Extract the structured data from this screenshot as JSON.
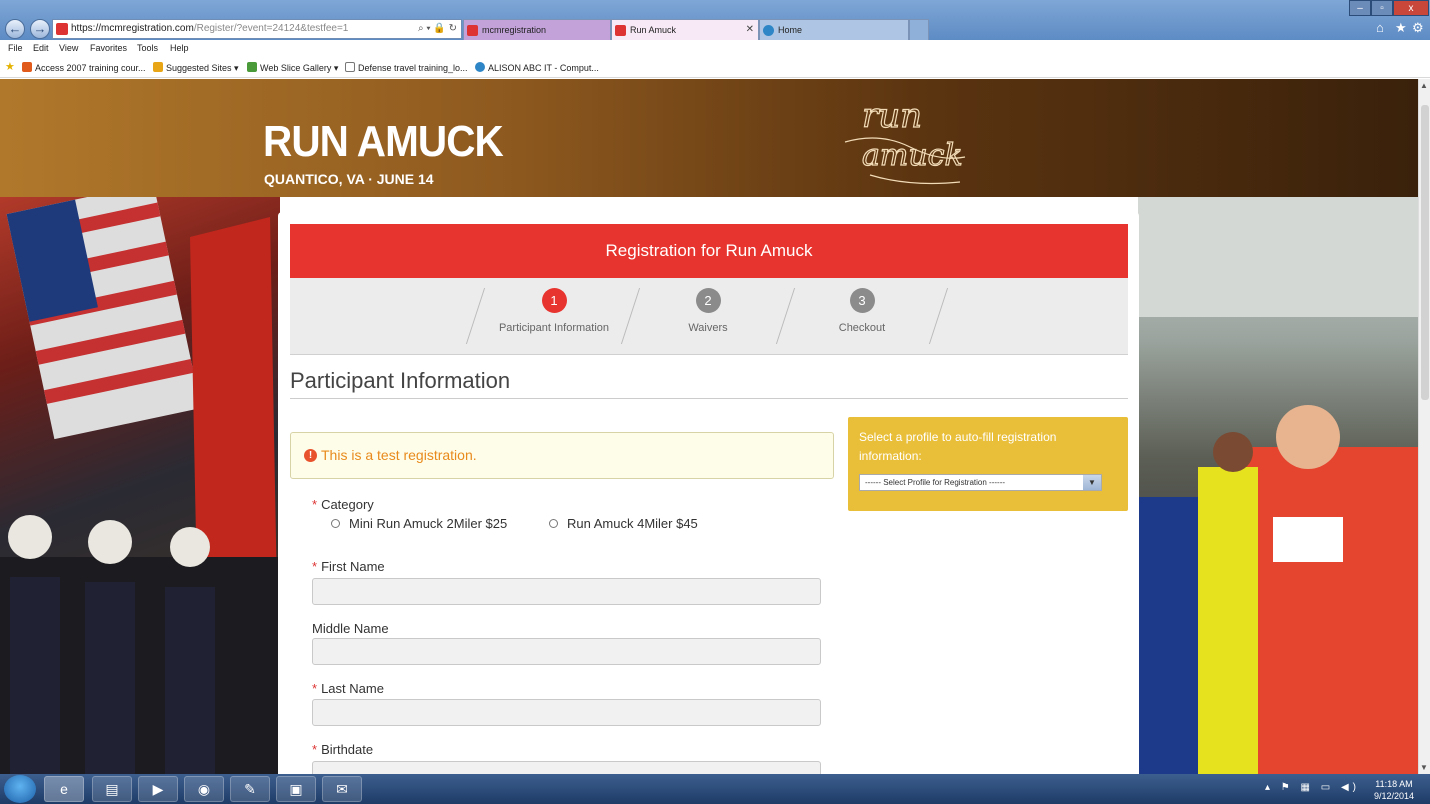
{
  "browser": {
    "address": {
      "url_main": "https://mcmregistration.com",
      "url_rest": "/Register/?event=24124&testfee=1"
    },
    "tabs": [
      {
        "label": "mcmregistration"
      },
      {
        "label": "Run Amuck"
      },
      {
        "label": "Home"
      }
    ],
    "menu": [
      "File",
      "Edit",
      "View",
      "Favorites",
      "Tools",
      "Help"
    ],
    "favorites": [
      "Access 2007 training cour...",
      "Suggested Sites ▾",
      "Web Slice Gallery ▾",
      "Defense travel training_lo...",
      "ALISON ABC IT - Comput..."
    ],
    "window_buttons": {
      "minimize": "–",
      "restore": "▫",
      "close": "x"
    }
  },
  "banner": {
    "title": "RUN AMUCK",
    "subtitle": "QUANTICO, VA · JUNE 14",
    "logo_line1": "run",
    "logo_line2": "amuck"
  },
  "registration": {
    "header": "Registration for Run Amuck",
    "steps": [
      {
        "num": "1",
        "label": "Participant Information"
      },
      {
        "num": "2",
        "label": "Waivers"
      },
      {
        "num": "3",
        "label": "Checkout"
      }
    ],
    "section_title": "Participant Information",
    "alert": "This is a test registration.",
    "alert_icon": "!",
    "fields": {
      "category_label": "Category",
      "category_options": [
        "Mini Run Amuck 2Miler $25",
        "Run Amuck 4Miler $45"
      ],
      "first_name": "First Name",
      "middle_name": "Middle Name",
      "last_name": "Last Name",
      "birthdate": "Birthdate"
    },
    "required_marker": "*",
    "profile": {
      "text": "Select a profile to auto-fill registration information:",
      "select_value": "------ Select Profile for Registration ------"
    }
  },
  "taskbar": {
    "time": "11:18 AM",
    "date": "9/12/2014"
  }
}
